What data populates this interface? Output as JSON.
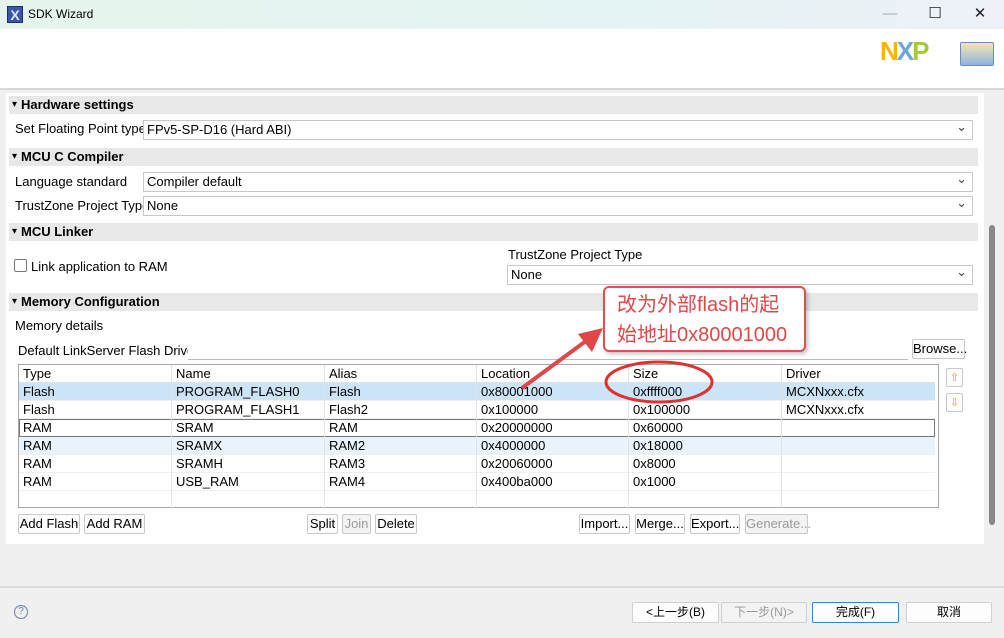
{
  "window": {
    "title": "SDK Wizard",
    "minimize": "—",
    "maximize": "☐",
    "close": "✕"
  },
  "logo": {
    "text": "NXP"
  },
  "hardware": {
    "title": "Hardware settings",
    "fp_label": "Set Floating Point type",
    "fp_value": "FPv5-SP-D16 (Hard ABI)"
  },
  "compiler": {
    "title": "MCU C Compiler",
    "lang_label": "Language standard",
    "lang_value": "Compiler default",
    "tz_label": "TrustZone Project Type",
    "tz_value": "None"
  },
  "linker": {
    "title": "MCU Linker",
    "link_ram_label": "Link application to RAM",
    "link_ram_checked": false,
    "tz_label": "TrustZone Project Type",
    "tz_value": "None"
  },
  "memory": {
    "title": "Memory Configuration",
    "details_label": "Memory details",
    "driver_label": "Default LinkServer Flash Driver",
    "driver_value": "",
    "browse": "Browse...",
    "columns": [
      "Type",
      "Name",
      "Alias",
      "Location",
      "Size",
      "Driver"
    ],
    "rows": [
      [
        "Flash",
        "PROGRAM_FLASH0",
        "Flash",
        "0x80001000",
        "0xffff000",
        "MCXNxxx.cfx"
      ],
      [
        "Flash",
        "PROGRAM_FLASH1",
        "Flash2",
        "0x100000",
        "0x100000",
        "MCXNxxx.cfx"
      ],
      [
        "RAM",
        "SRAM",
        "RAM",
        "0x20000000",
        "0x60000",
        ""
      ],
      [
        "RAM",
        "SRAMX",
        "RAM2",
        "0x4000000",
        "0x18000",
        ""
      ],
      [
        "RAM",
        "SRAMH",
        "RAM3",
        "0x20060000",
        "0x8000",
        ""
      ],
      [
        "RAM",
        "USB_RAM",
        "RAM4",
        "0x400ba000",
        "0x1000",
        ""
      ]
    ],
    "buttons": {
      "add_flash": "Add Flash",
      "add_ram": "Add RAM",
      "split": "Split",
      "join": "Join",
      "delete": "Delete",
      "import": "Import...",
      "merge": "Merge...",
      "export": "Export...",
      "generate": "Generate..."
    }
  },
  "annotation": {
    "line1": "改为外部flash的起",
    "line2": "始地址0x80001000",
    "color": "#e04848"
  },
  "footer": {
    "help": "?",
    "back": "<上一步(B)",
    "next": "下一步(N)>",
    "finish": "完成(F)",
    "cancel": "取消"
  }
}
